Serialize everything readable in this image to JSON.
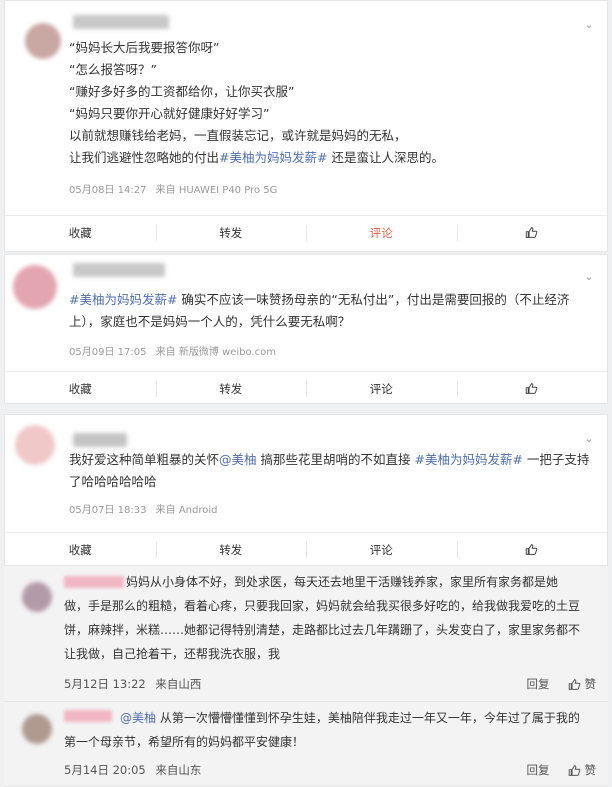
{
  "posts": [
    {
      "lines": [
        [
          {
            "t": "“妈妈长大后我要报答你呀”"
          }
        ],
        [
          {
            "t": "“怎么报答呀？”"
          }
        ],
        [
          {
            "t": "“赚好多好多的工资都给你，让你买衣服”"
          }
        ],
        [
          {
            "t": "“妈妈只要你开心就好健康好好学习”"
          }
        ],
        [
          {
            "t": "以前就想赚钱给老妈，一直假装忘记，或许就是妈妈的无私，"
          }
        ],
        [
          {
            "t": "让我们逃避性忽略她的付出"
          },
          {
            "t": "#美柚为妈妈发薪#",
            "blue": true
          },
          {
            "t": " 还是蛮让人深思的。"
          }
        ]
      ],
      "date": "05月08日 14:27",
      "source": "来自 HUAWEI P40 Pro 5G",
      "actions": {
        "fav": "收藏",
        "repost": "转发",
        "comment": "评论"
      }
    },
    {
      "lines": [
        [
          {
            "t": "#美柚为妈妈发薪#",
            "blue": true
          },
          {
            "t": " 确实不应该一味赞扬母亲的“无私付出”，付出是需要回报的（不止经济"
          }
        ],
        [
          {
            "t": "上），家庭也不是妈妈一个人的，凭什么要无私啊？"
          }
        ]
      ],
      "date": "05月09日 17:05",
      "source": "来自 新版微博 weibo.com",
      "actions": {
        "fav": "收藏",
        "repost": "转发",
        "comment": "评论"
      }
    },
    {
      "lines": [
        [
          {
            "t": "我好爱这种简单粗暴的关怀"
          },
          {
            "t": "@美柚",
            "blue": true
          },
          {
            "t": " 搞那些花里胡哨的不如直接 "
          },
          {
            "t": "#美柚为妈妈发薪#",
            "blue": true
          },
          {
            "t": " 一把子支持"
          }
        ],
        [
          {
            "t": "了哈哈哈哈哈哈"
          }
        ]
      ],
      "date": "05月07日 18:33",
      "source": "来自 Android",
      "actions": {
        "fav": "收藏",
        "repost": "转发",
        "comment": "评论"
      }
    }
  ],
  "comments": [
    {
      "lines": [
        [
          {
            "t": "妈妈从小身体不好，到处求医，每天还去地里干活赚钱养家，家里所有家务都是她"
          }
        ],
        [
          {
            "t": "做，手是那么的粗糙，看着心疼，只要我回家，妈妈就会给我买很多好吃的，给我做我爱吃的土豆"
          }
        ],
        [
          {
            "t": "饼，麻辣拌，米糕……她都记得特别清楚，走路都比过去几年蹒跚了，头发变白了，家里家务都不"
          }
        ],
        [
          {
            "t": "让我做，自己抢着干，还帮我洗衣服，我"
          }
        ]
      ],
      "date": "5月12日 13:22",
      "loc": "来自山西",
      "reply": "回复",
      "like": "赞"
    },
    {
      "lines": [
        [
          {
            "t": "@美柚",
            "blue": true
          },
          {
            "t": " 从第一次懵懵懂懂到怀孕生娃，美柚陪伴我走过一年又一年，今年过了属于我的"
          }
        ],
        [
          {
            "t": "第一个母亲节，希望所有的妈妈都平安健康！"
          }
        ]
      ],
      "date": "5月14日 20:05",
      "loc": "来自山东",
      "reply": "回复",
      "like": "赞"
    }
  ]
}
